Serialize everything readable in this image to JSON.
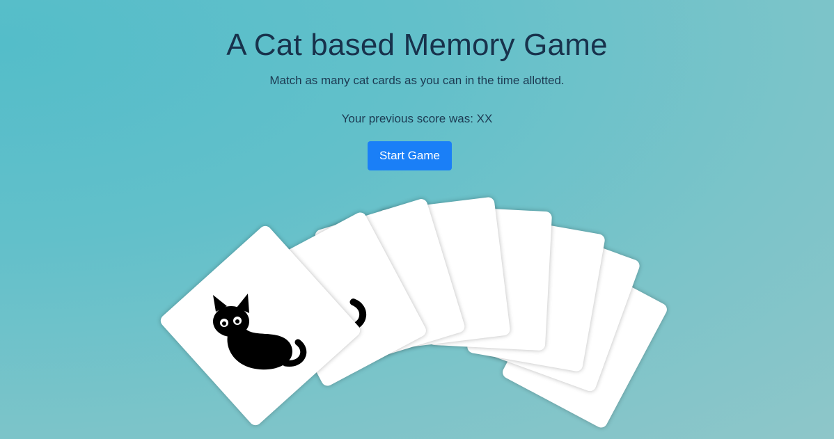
{
  "header": {
    "title": "A Cat based Memory Game",
    "subtitle": "Match as many cat cards as you can in the time allotted.",
    "previous_score": "Your previous score was: XX"
  },
  "controls": {
    "start_label": "Start Game"
  },
  "cards": [
    {
      "state": "face-up",
      "icon": "black-cat-icon"
    },
    {
      "state": "stacked",
      "icon": "cat-tail-icon"
    },
    {
      "state": "stacked",
      "icon": "cat-tail-icon"
    },
    {
      "state": "stacked",
      "icon": "cat-tail-icon"
    },
    {
      "state": "stacked",
      "icon": "cat-tail-icon"
    },
    {
      "state": "stacked",
      "icon": "cat-tail-icon"
    },
    {
      "state": "stacked",
      "icon": "cat-tail-icon"
    },
    {
      "state": "stacked",
      "icon": "cat-tail-icon"
    }
  ],
  "colors": {
    "accent": "#1a7ff7",
    "background_start": "#54bdc9",
    "background_end": "#8ec6c9",
    "title": "#18324c"
  }
}
